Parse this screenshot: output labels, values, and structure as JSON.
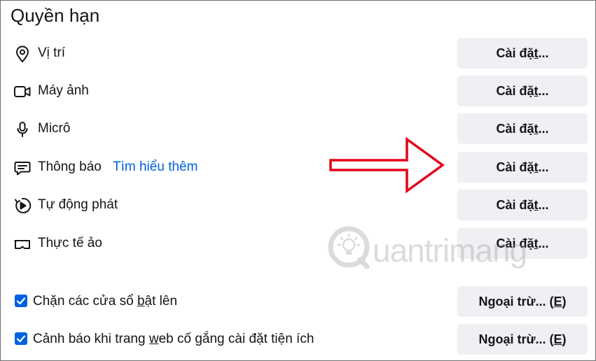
{
  "section": {
    "title": "Quyền hạn"
  },
  "permissions": [
    {
      "label": "Vị trí",
      "icon": "location-pin-icon",
      "button": {
        "pre": "Cài đặ",
        "key": "t",
        "post": "..."
      }
    },
    {
      "label": "Máy ảnh",
      "icon": "camera-icon",
      "button": {
        "pre": "Cài đặ",
        "key": "t",
        "post": "..."
      }
    },
    {
      "label": "Micrô",
      "icon": "microphone-icon",
      "button": {
        "pre": "Cài đặ",
        "key": "t",
        "post": "..."
      }
    },
    {
      "label": "Thông báo",
      "icon": "notification-icon",
      "learn_more": "Tìm hiểu thêm",
      "button": {
        "pre": "Cài đặ",
        "key": "t",
        "post": "..."
      }
    },
    {
      "label": "Tự động phát",
      "icon": "autoplay-icon",
      "button": {
        "pre": "Cài đặ",
        "key": "t",
        "post": "..."
      }
    },
    {
      "label": "Thực tế ảo",
      "icon": "vr-headset-icon",
      "button": {
        "pre": "Cài đặ",
        "key": "t",
        "post": "..."
      }
    }
  ],
  "checkboxes": [
    {
      "checked": true,
      "label_pre": "Chặn các cửa sổ ",
      "label_key": "b",
      "label_post": "ật lên",
      "button": {
        "pre": "Ngoại trừ... (",
        "key": "E",
        "post": ")"
      }
    },
    {
      "checked": true,
      "label_pre": "Cảnh báo khi trang ",
      "label_key": "w",
      "label_post": "eb cố gắng cài đặt tiện ích",
      "button": {
        "pre": "Ngoại trừ... (",
        "key": "E",
        "post": ")"
      }
    }
  ],
  "colors": {
    "accent": "#0061e0",
    "button_bg": "#f0f0f4",
    "text": "#15141a",
    "annotation_arrow": "#e3001b"
  },
  "watermark": {
    "text": "uantrimang"
  }
}
